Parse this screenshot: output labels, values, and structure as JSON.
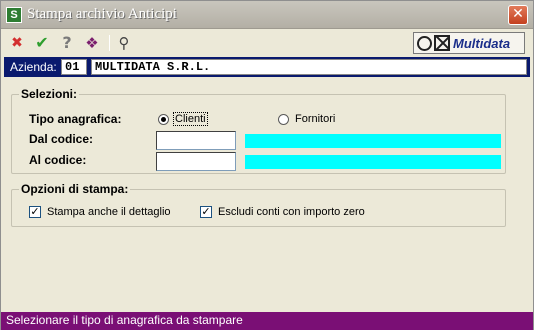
{
  "window": {
    "title": "Stampa archivio Anticipi",
    "app_icon_letter": "S",
    "close_glyph": "✕"
  },
  "toolbar": {
    "cancel_glyph": "✖",
    "confirm_glyph": "✔",
    "help_glyph": "?",
    "book_glyph": "❖",
    "binoculars_glyph": "⚲",
    "logo_text": "Multidata",
    "colors": {
      "cancel": "#d32f2f",
      "confirm": "#2e9e2e",
      "help": "#7a7a7a"
    }
  },
  "azienda": {
    "label": "Azienda:",
    "code": "01",
    "name": "MULTIDATA S.R.L."
  },
  "selezioni": {
    "title": "Selezioni:",
    "tipo_label": "Tipo anagrafica:",
    "option_clienti": "Clienti",
    "option_fornitori": "Fornitori",
    "selected": "Clienti",
    "dal_label": "Dal codice:",
    "al_label": "Al codice:",
    "dal_value": "",
    "al_value": ""
  },
  "opzioni": {
    "title": "Opzioni di stampa:",
    "dettaglio_label": "Stampa anche il dettaglio",
    "dettaglio_checked": true,
    "escludi_label": "Escludi conti con importo zero",
    "escludi_checked": true,
    "check_glyph": "✓"
  },
  "status": {
    "text": "Selezionare il tipo di anagrafica da stampare"
  }
}
